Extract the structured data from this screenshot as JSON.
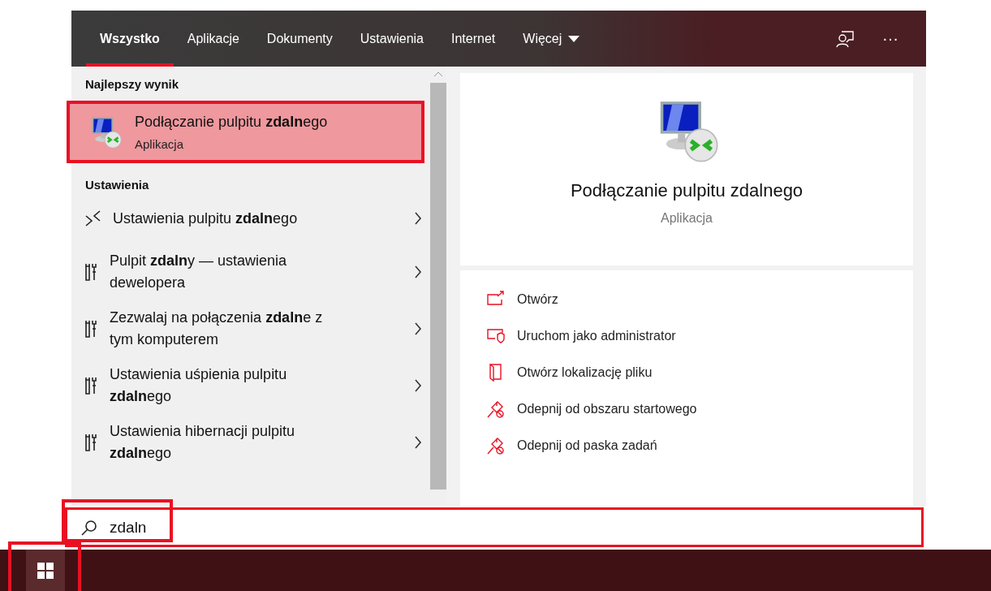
{
  "tabs": [
    {
      "label": "Wszystko",
      "selected": true,
      "dropdown": false
    },
    {
      "label": "Aplikacje",
      "selected": false,
      "dropdown": false
    },
    {
      "label": "Dokumenty",
      "selected": false,
      "dropdown": false
    },
    {
      "label": "Ustawienia",
      "selected": false,
      "dropdown": false
    },
    {
      "label": "Internet",
      "selected": false,
      "dropdown": false
    },
    {
      "label": "Więcej",
      "selected": false,
      "dropdown": true
    }
  ],
  "header_more": "···",
  "best_result": {
    "heading": "Najlepszy wynik",
    "title": "Podłączanie pulpitu **zdaln**ego",
    "subtitle": "Aplikacja",
    "highlighted": true
  },
  "settings": {
    "heading": "Ustawienia",
    "items": [
      {
        "kind": "remote",
        "label": "Ustawienia pulpitu **zdaln**ego"
      },
      {
        "kind": "tools",
        "label": "Pulpit **zdaln**y — ustawienia dewelopera"
      },
      {
        "kind": "tools",
        "label": "Zezwalaj na połączenia **zdaln**e z tym komputerem"
      },
      {
        "kind": "tools",
        "label": "Ustawienia uśpienia pulpitu **zdaln**ego"
      },
      {
        "kind": "tools",
        "label": "Ustawienia hibernacji pulpitu **zdaln**ego"
      }
    ]
  },
  "preview": {
    "title": "Podłączanie pulpitu zdalnego",
    "subtitle": "Aplikacja"
  },
  "actions": [
    {
      "kind": "open",
      "label": "Otwórz"
    },
    {
      "kind": "admin",
      "label": "Uruchom jako administrator"
    },
    {
      "kind": "folder",
      "label": "Otwórz lokalizację pliku"
    },
    {
      "kind": "unpin",
      "label": "Odepnij od obszaru startowego"
    },
    {
      "kind": "unpin",
      "label": "Odepnij od paska zadań"
    }
  ],
  "search": {
    "value": "zdaln",
    "highlighted": true,
    "icon_highlighted": true
  },
  "taskbar": {
    "start_highlighted": true
  }
}
